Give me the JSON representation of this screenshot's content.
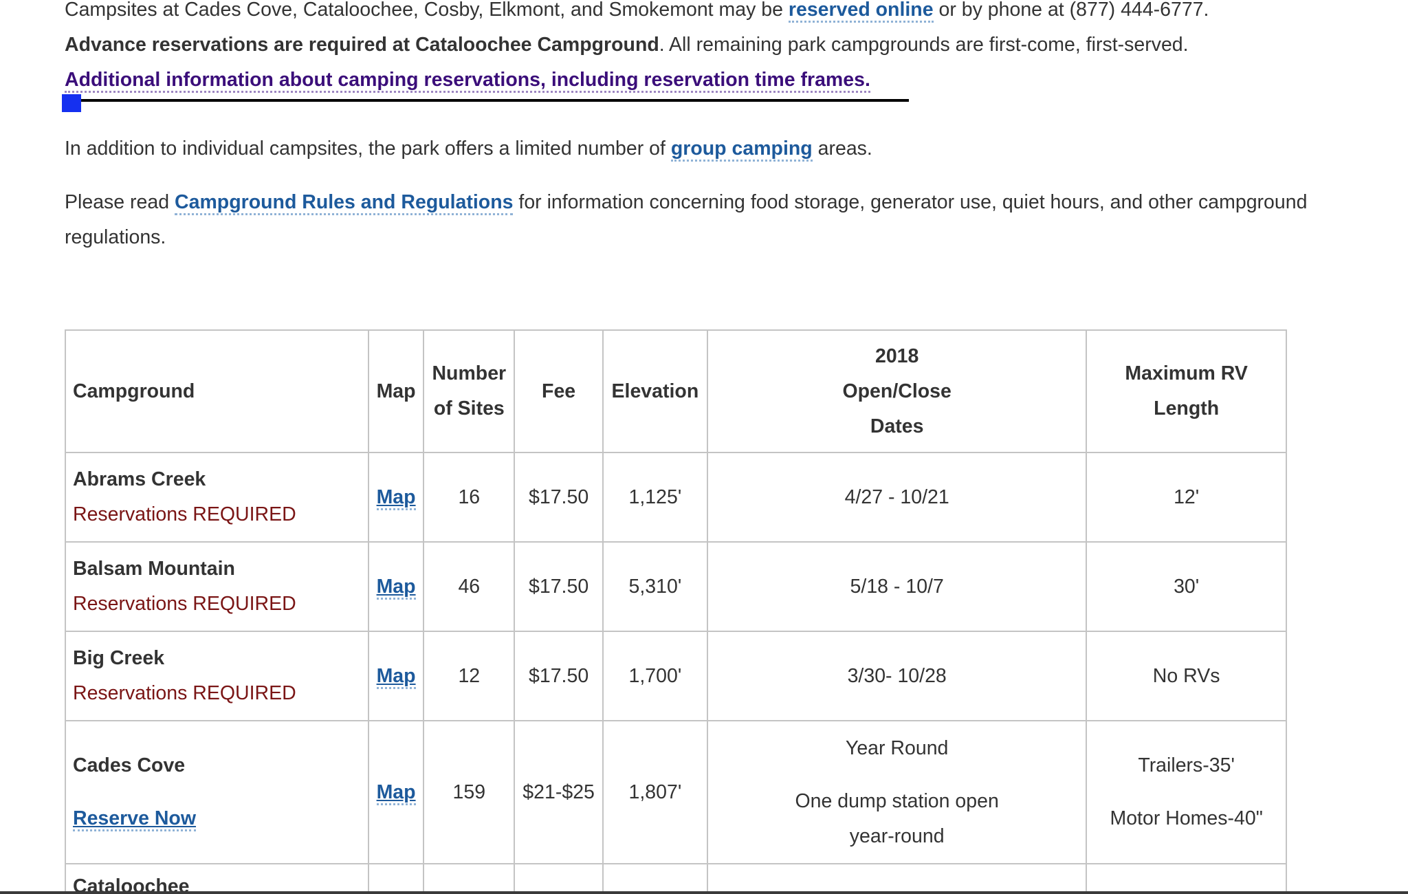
{
  "intro": {
    "p1_prefix": "Campsites at Cades Cove, Cataloochee, Cosby, Elkmont, and Smokemont may be ",
    "p1_link": "reserved online",
    "p1_mid": " or by phone at (877) 444-6777.",
    "p1_bold": "Advance reservations are required at Cataloochee Campground",
    "p1_suffix": ". All remaining park campgrounds are first-come, first-served.",
    "p1_link2": "Additional information about camping reservations, including reservation time frames.",
    "p3_prefix": "In addition to individual campsites, the park offers a limited number of ",
    "p3_link": "group camping",
    "p3_suffix": " areas.",
    "p4_prefix": "Please read ",
    "p4_link": "Campground Rules and Regulations",
    "p4_suffix": " for information concerning food storage, generator use, quiet hours, and other campground regulations."
  },
  "table": {
    "headers": {
      "campground": "Campground",
      "map": "Map",
      "sites_line1": "Number",
      "sites_line2": "of Sites",
      "fee": "Fee",
      "elevation": "Elevation",
      "dates_line1": "2018",
      "dates_line2": "Open/Close",
      "dates_line3": "Dates",
      "rv_line1": "Maximum RV",
      "rv_line2": "Length"
    },
    "rows": [
      {
        "name": "Abrams Creek",
        "note": "Reservations REQUIRED",
        "map": "Map",
        "sites": "16",
        "fee": "$17.50",
        "elevation": "1,125'",
        "dates": "4/27 - 10/21",
        "rv": "12'"
      },
      {
        "name": "Balsam Mountain",
        "note": "Reservations REQUIRED",
        "map": "Map",
        "sites": "46",
        "fee": "$17.50",
        "elevation": "5,310'",
        "dates": "5/18 - 10/7",
        "rv": "30'"
      },
      {
        "name": "Big Creek",
        "note": "Reservations REQUIRED",
        "map": "Map",
        "sites": "12",
        "fee": "$17.50",
        "elevation": "1,700'",
        "dates": "3/30- 10/28",
        "rv": "No RVs"
      },
      {
        "name": "Cades Cove",
        "reserve": "Reserve Now",
        "map": "Map",
        "sites": "159",
        "fee": "$21-$25",
        "elevation": "1,807'",
        "dates_line1": "Year Round",
        "dates_line2": "One dump station open year-round",
        "rv_line1": "Trailers-35'",
        "rv_line2": "Motor Homes-40\""
      },
      {
        "name": "Cataloochee"
      }
    ]
  }
}
